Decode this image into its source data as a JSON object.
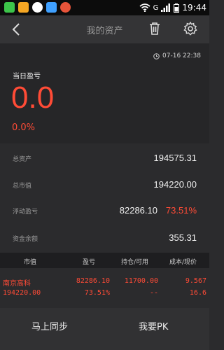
{
  "status_bar": {
    "time": "19:44",
    "network": "G",
    "app_icons": [
      "#3cc44a",
      "#f5a623",
      "#ffffff",
      "#3fa0ff",
      "#e8543a"
    ]
  },
  "header": {
    "title": "我的资产",
    "back_icon": "chevron-left-icon",
    "delete_icon": "trash-icon",
    "settings_icon": "gear-icon"
  },
  "summary": {
    "time": "07-16 22:38",
    "today_label": "当日盈亏",
    "today_value": "0.0",
    "today_pct": "0.0%"
  },
  "assets": {
    "total_label": "总资产",
    "total_value": "194575.31",
    "market_label": "总市值",
    "market_value": "194220.00",
    "float_label": "浮动盈亏",
    "float_value": "82286.10",
    "float_pct": "73.51%",
    "cash_label": "资金余额",
    "cash_value": "355.31"
  },
  "table": {
    "headers": [
      "市值",
      "盈亏",
      "持仓/可用",
      "成本/现价"
    ],
    "rows": [
      {
        "name": "南京高科",
        "market_value": "194220.00",
        "profit": "82286.10",
        "profit_pct": "73.51%",
        "holding": "11700.00",
        "available": "--",
        "cost": "9.567",
        "price": "16.6"
      }
    ]
  },
  "bottom_bar": {
    "sync_label": "马上同步",
    "pk_label": "我要PK"
  },
  "colors": {
    "accent_red": "#ff4b36",
    "background": "#2b2b2d",
    "header_bg": "#343436"
  }
}
